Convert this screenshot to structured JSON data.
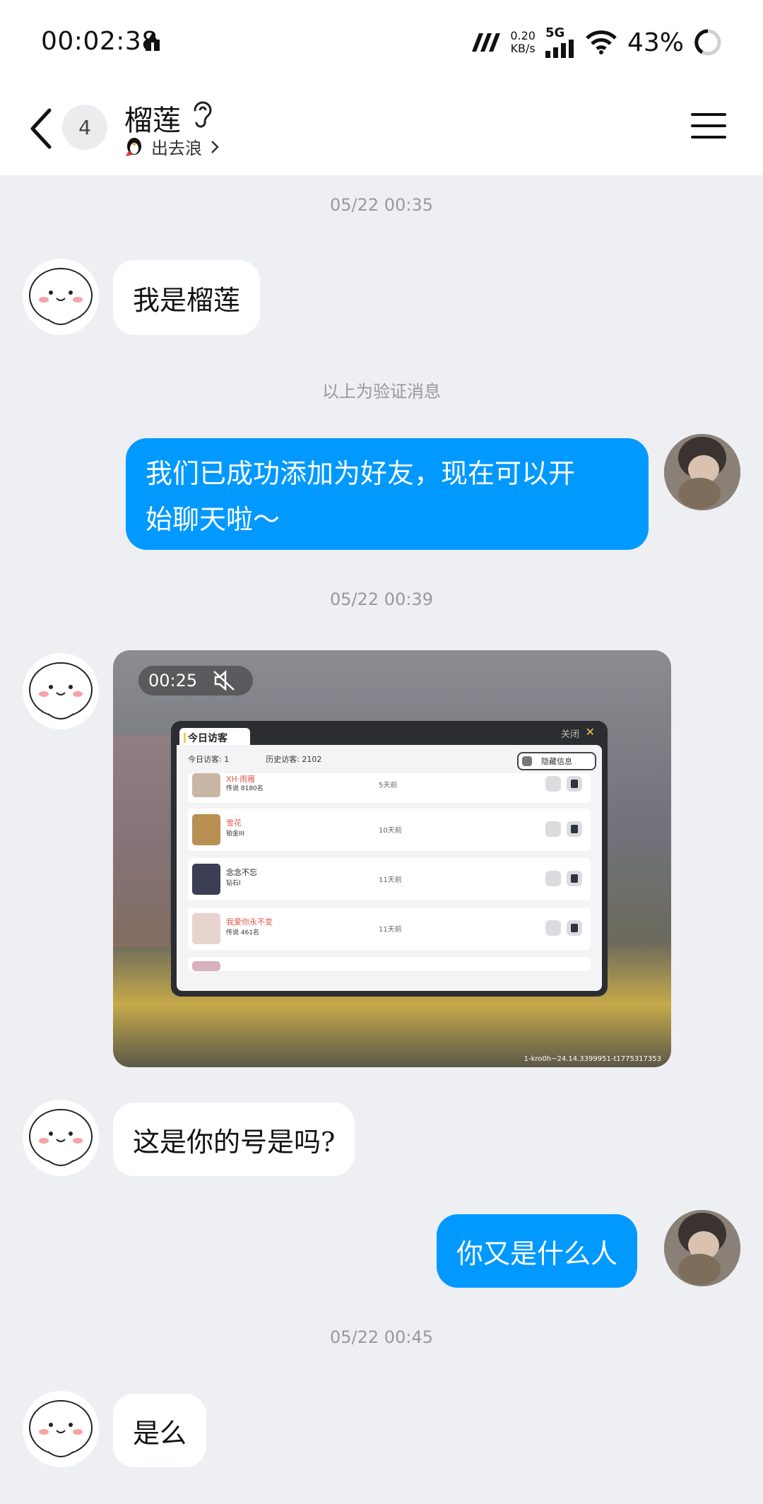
{
  "status_bar": {
    "time": "00:02:38",
    "net_speed_value": "0.20",
    "net_speed_unit": "KB/s",
    "network": "5G",
    "battery": "43%"
  },
  "header": {
    "unread_count": "4",
    "contact_name": "榴莲",
    "contact_status": "出去浪"
  },
  "messages": {
    "ts1": "05/22 00:35",
    "m1": "我是榴莲",
    "verify_notice": "以上为验证消息",
    "m2_line1": "我们已成功添加为好友，现在可以开",
    "m2_line2": "始聊天啦～",
    "ts2": "05/22 00:39",
    "video": {
      "duration": "00:25",
      "popup_title": "今日访客",
      "popup_close": "关闭",
      "today_visitors": "今日访客: 1",
      "history_visitors": "历史访客: 2102",
      "hide_info": "隐藏信息",
      "rows": [
        {
          "name": "XH·雨雁",
          "sub": "传说 8180名",
          "time": "5天前"
        },
        {
          "name": "雪花",
          "sub": "铂金III",
          "time": "10天前"
        },
        {
          "name": "念念不忘",
          "sub": "钻石I",
          "time": "11天前"
        },
        {
          "name": "我爱你永不变",
          "sub": "传说 461名",
          "time": "11天前"
        }
      ],
      "video_id": "1-kro0h~24.14.3399951-t1775317353"
    },
    "m3": "这是你的号是吗?",
    "m4": "你又是什么人",
    "ts3": "05/22 00:45",
    "m5": "是么"
  },
  "colors": {
    "accent_blue": "#0099FF",
    "background": "#EEEFF3"
  }
}
